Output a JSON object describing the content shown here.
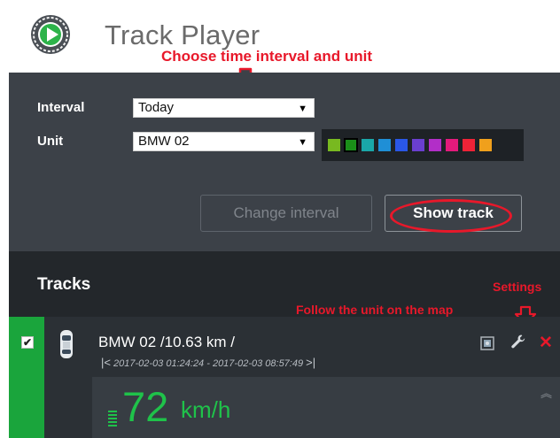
{
  "header": {
    "title": "Track Player"
  },
  "annotations": {
    "interval": "Choose time interval and unit",
    "follow": "Follow the unit on the map",
    "settings": "Settings"
  },
  "form": {
    "interval_label": "Interval",
    "interval_value": "Today",
    "unit_label": "Unit",
    "unit_value": "BMW 02",
    "palette": [
      "#78b920",
      "#1a8f18",
      "#1aa7a8",
      "#1f8fd6",
      "#2a57e6",
      "#6a3fcf",
      "#b22ec8",
      "#e41a7c",
      "#ef2337",
      "#f0a01c"
    ],
    "palette_selected": 1,
    "change_interval": "Change interval",
    "show_track": "Show track"
  },
  "tracks": {
    "heading": "Tracks",
    "items": [
      {
        "name": "BMW 02 /10.63 km /",
        "time_range": "2017-02-03 01:24:24 - 2017-02-03 08:57:49",
        "speed_value": "72",
        "speed_unit": "km/h",
        "checked": true
      }
    ]
  },
  "colors": {
    "accent_red": "#e8182a",
    "speed_green": "#1fc24a",
    "strip_green": "#1aa53c"
  }
}
